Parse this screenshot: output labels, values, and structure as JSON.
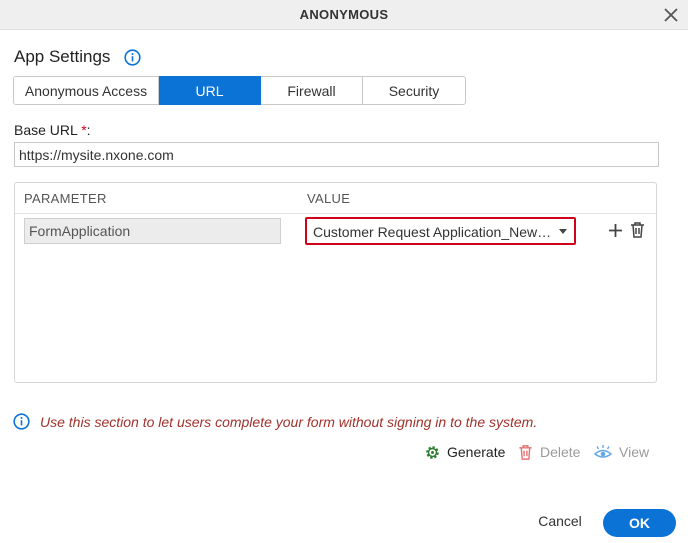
{
  "dialog": {
    "title": "ANONYMOUS"
  },
  "app_settings": {
    "heading": "App Settings"
  },
  "tabs": [
    {
      "label": "Anonymous Access"
    },
    {
      "label": "URL",
      "active": true
    },
    {
      "label": "Firewall"
    },
    {
      "label": "Security"
    }
  ],
  "base_url": {
    "label": "Base URL",
    "required_mark": "*",
    "colon": ":",
    "value": "https://mysite.nxone.com"
  },
  "table": {
    "headers": [
      "PARAMETER",
      "VALUE"
    ],
    "rows": [
      {
        "parameter": "FormApplication",
        "value": "Customer Request Application_New Form"
      }
    ]
  },
  "note": "Use this section to let users complete your form without signing in to the system.",
  "actions": {
    "generate": "Generate",
    "delete": "Delete",
    "view": "View"
  },
  "footer": {
    "cancel": "Cancel",
    "ok": "OK"
  },
  "colors": {
    "accent": "#0b72d6",
    "error": "#d0021b",
    "note_text": "#a1322c",
    "generate_icon": "#2e7d32"
  },
  "icons": {
    "close": "close-icon",
    "info": "info-icon",
    "plus": "plus-icon",
    "trash": "trash-icon",
    "gear": "gear-icon",
    "eye": "eye-icon"
  }
}
